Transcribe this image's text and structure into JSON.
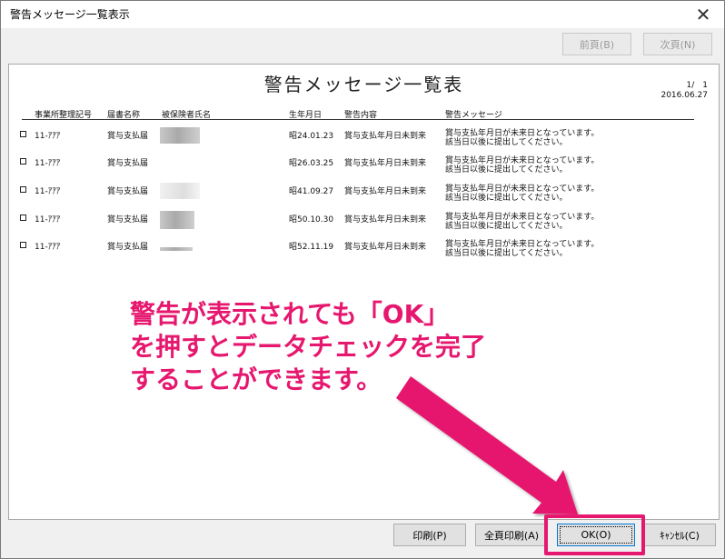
{
  "window": {
    "title": "警告メッセージ一覧表示",
    "close_glyph": "✕"
  },
  "nav": {
    "prev_label": "前頁(B)",
    "next_label": "次頁(N)"
  },
  "report": {
    "title": "警告メッセージ一覧表",
    "page": "1/　1",
    "date": "2016.06.27",
    "columns": {
      "office_no": "事業所整理記号",
      "form_name": "届書名称",
      "insured_name": "被保険者氏名",
      "birth_date": "生年月日",
      "warning_content": "警告内容",
      "warning_message": "警告メッセージ"
    },
    "rows": [
      {
        "office_no": "11-ｱｱｱ",
        "form_name": "賞与支払届",
        "birth_date": "昭24.01.23",
        "warning_content": "賞与支払年月日未到来",
        "message_line1": "賞与支払年月日が未来日となっています。",
        "message_line2": "該当日以後に提出してください。"
      },
      {
        "office_no": "11-ｱｱｱ",
        "form_name": "賞与支払届",
        "birth_date": "昭26.03.25",
        "warning_content": "賞与支払年月日未到来",
        "message_line1": "賞与支払年月日が未来日となっています。",
        "message_line2": "該当日以後に提出してください。"
      },
      {
        "office_no": "11-ｱｱｱ",
        "form_name": "賞与支払届",
        "birth_date": "昭41.09.27",
        "warning_content": "賞与支払年月日未到来",
        "message_line1": "賞与支払年月日が未来日となっています。",
        "message_line2": "該当日以後に提出してください。"
      },
      {
        "office_no": "11-ｱｱｱ",
        "form_name": "賞与支払届",
        "birth_date": "昭50.10.30",
        "warning_content": "賞与支払年月日未到来",
        "message_line1": "賞与支払年月日が未来日となっています。",
        "message_line2": "該当日以後に提出してください。"
      },
      {
        "office_no": "11-ｱｱｱ",
        "form_name": "賞与支払届",
        "birth_date": "昭52.11.19",
        "warning_content": "賞与支払年月日未到来",
        "message_line1": "賞与支払年月日が未来日となっています。",
        "message_line2": "該当日以後に提出してください。"
      }
    ]
  },
  "buttons": {
    "print_label": "印刷(P)",
    "print_all_label": "全頁印刷(A)",
    "ok_label": "OK(O)",
    "cancel_label": "ｷｬﾝｾﾙ(C)"
  },
  "annotation": {
    "line1": "警告が表示されても「OK」",
    "line2": "を押すとデータチェックを完了",
    "line3": "することができます。",
    "color": "#e6176e"
  }
}
